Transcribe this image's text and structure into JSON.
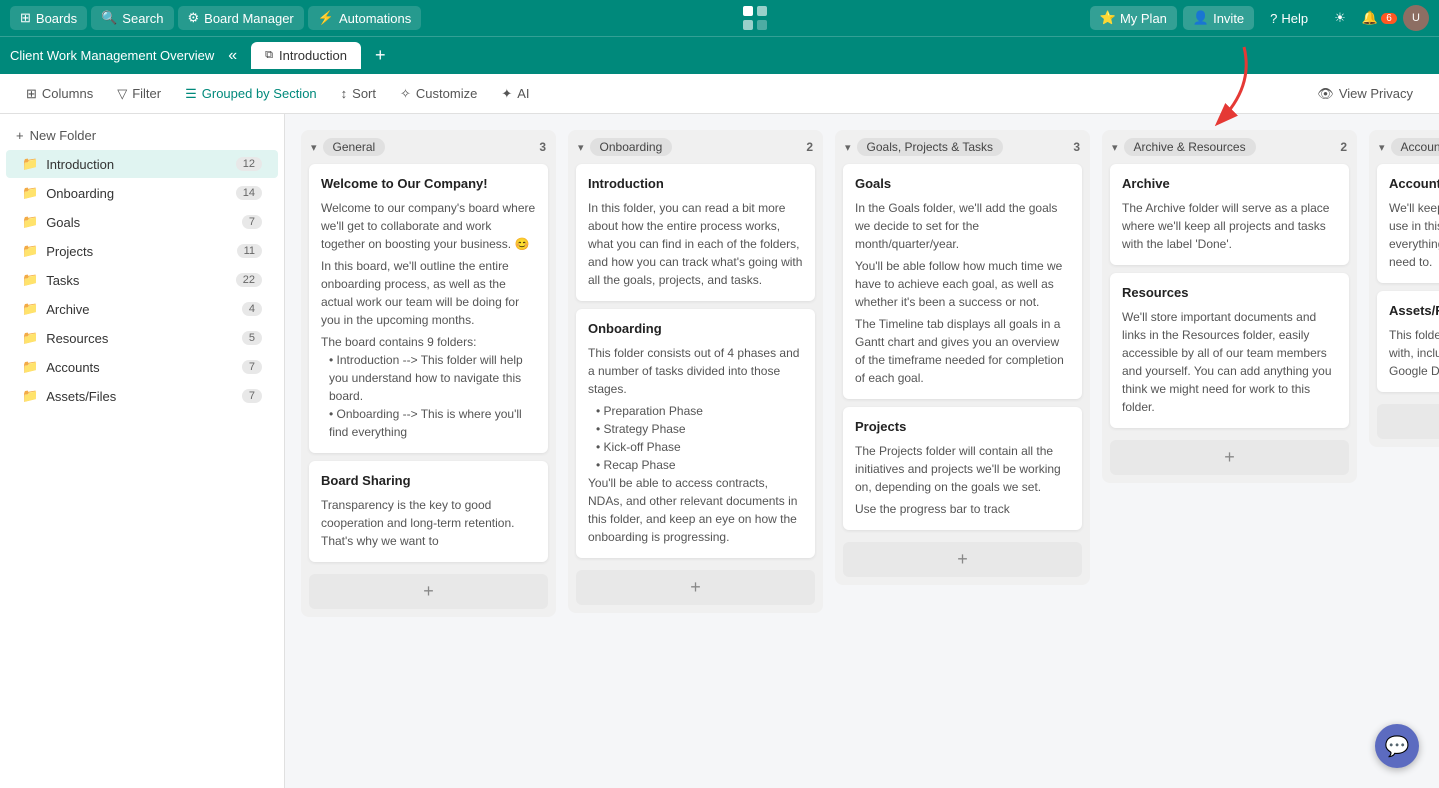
{
  "topnav": {
    "boards_label": "Boards",
    "search_label": "Search",
    "board_manager_label": "Board Manager",
    "automations_label": "Automations",
    "my_plan_label": "My Plan",
    "invite_label": "Invite",
    "help_label": "Help",
    "notifications_count": "6"
  },
  "breadcrumb": {
    "title": "Client Work Management Overview",
    "tab_label": "Introduction"
  },
  "toolbar": {
    "columns_label": "Columns",
    "filter_label": "Filter",
    "grouped_by_section_label": "Grouped by Section",
    "sort_label": "Sort",
    "customize_label": "Customize",
    "ai_label": "AI",
    "view_privacy_label": "View Privacy"
  },
  "sidebar": {
    "new_folder_label": "+ New Folder",
    "items": [
      {
        "label": "Introduction",
        "count": "12",
        "active": true
      },
      {
        "label": "Onboarding",
        "count": "14"
      },
      {
        "label": "Goals",
        "count": "7"
      },
      {
        "label": "Projects",
        "count": "11"
      },
      {
        "label": "Tasks",
        "count": "22"
      },
      {
        "label": "Archive",
        "count": "4"
      },
      {
        "label": "Resources",
        "count": "5"
      },
      {
        "label": "Accounts",
        "count": "7"
      },
      {
        "label": "Assets/Files",
        "count": "7"
      }
    ]
  },
  "columns": [
    {
      "id": "general",
      "tag": "General",
      "count": "3",
      "cards": [
        {
          "title": "Welcome to Our Company!",
          "body": "Welcome to our company's board where we'll get to collaborate and work together on boosting your business. 😊\n*\nIn this board, we'll outline the entire onboarding process, as well as the actual work our team will be doing for you in the upcoming months.\n*\nThe board contains 9 folders:\n• Introduction --> This folder will help you understand how to navigate this board.\n• Onboarding --> This is where you'll find everything"
        },
        {
          "title": "Board Sharing",
          "body": "Transparency is the key to good cooperation and long-term retention. That's why we want to"
        }
      ]
    },
    {
      "id": "onboarding",
      "tag": "Onboarding",
      "count": "2",
      "cards": [
        {
          "title": "Introduction",
          "body": "In this folder, you can read a bit more about how the entire process works, what you can find in each of the folders, and how you can track what's going with all the goals, projects, and tasks."
        },
        {
          "title": "Onboarding",
          "body": "This folder consists out of 4 phases and a number of tasks divided into those stages.\n*\n• Preparation Phase\n• Strategy Phase\n• Kick-off Phase\n• Recap Phase\nYou'll be able to access contracts, NDAs, and other relevant documents in this folder, and keep an eye on how the onboarding is progressing."
        }
      ]
    },
    {
      "id": "goals",
      "tag": "Goals, Projects & Tasks",
      "count": "3",
      "cards": [
        {
          "title": "Goals",
          "body": "In the Goals folder, we'll add the goals we decide to set for the month/quarter/year.\n*\nYou'll be able follow how much time we have to achieve each goal, as well as whether it's been a success or not.\n*\nThe Timeline tab displays all goals in a Gantt chart and gives you an overview of the timeframe needed for completion of each goal."
        },
        {
          "title": "Projects",
          "body": "The Projects folder will contain all the initiatives and projects we'll be working on, depending on the goals we set.\n*\nUse the progress bar to track"
        }
      ]
    },
    {
      "id": "archive",
      "tag": "Archive & Resources",
      "count": "2",
      "cards": [
        {
          "title": "Archive",
          "body": "The Archive folder will serve as a place where we'll keep all projects and tasks with the label 'Done'."
        },
        {
          "title": "Resources",
          "body": "We'll store important documents and links in the Resources folder, easily accessible by all of our team members and yourself. You can add anything you think we might need for work to this folder."
        }
      ]
    },
    {
      "id": "accounts",
      "tag": "Accounts & As...",
      "count": "",
      "cards": [
        {
          "title": "Accounts",
          "body": "We'll keep all pass emails to differen use in this folder. Accounts folder t everything in one quickly add new a we need to."
        },
        {
          "title": "Assets/Files",
          "body": "This folder makes manage any files with, including im Figma or Photosh Google Docs, etc"
        }
      ]
    }
  ]
}
